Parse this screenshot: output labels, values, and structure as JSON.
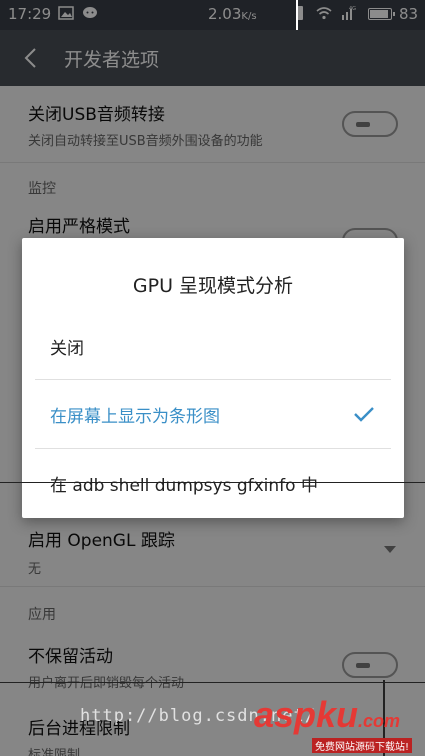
{
  "status_bar": {
    "time": "17:29",
    "data_rate": "2.03",
    "data_unit": "K/s",
    "signal": "4G",
    "battery": "83"
  },
  "app_bar": {
    "title": "开发者选项"
  },
  "settings": {
    "usb_audio": {
      "title": "关闭USB音频转接",
      "subtitle": "关闭自动转接至USB音频外围设备的功能"
    },
    "section_monitoring": "监控",
    "strict_mode": {
      "title": "启用严格模式"
    },
    "opengl_trace": {
      "title": "启用 OpenGL 跟踪",
      "value": "无"
    },
    "section_apps": "应用",
    "dont_keep_activities": {
      "title": "不保留活动",
      "subtitle": "用户离开后即销毁每个活动"
    },
    "background_limit": {
      "title": "后台进程限制",
      "value": "标准限制"
    }
  },
  "dialog": {
    "title": "GPU 呈现模式分析",
    "options": [
      {
        "label": "关闭",
        "selected": false
      },
      {
        "label": "在屏幕上显示为条形图",
        "selected": true
      },
      {
        "label": "在 adb shell dumpsys gfxinfo 中",
        "selected": false
      }
    ]
  },
  "colors": {
    "accent": "#3a8fc7",
    "app_bar": "#4a4f57",
    "status_bar": "#3a3f47"
  },
  "watermark": {
    "url": "http://blog.csdn.net/",
    "logo": "aspku",
    "logo_tld": ".com",
    "tagline": "免费网站源码下载站!"
  }
}
